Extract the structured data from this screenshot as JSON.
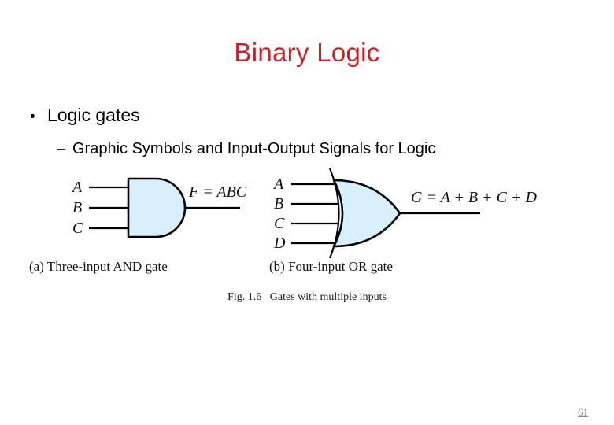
{
  "slide": {
    "title": "Binary Logic",
    "title_color": "#cc2026",
    "background_color": "#ffffff",
    "page_number": "61"
  },
  "bullets": {
    "level1": {
      "marker": "•",
      "text": "Logic gates"
    },
    "level2": {
      "marker": "–",
      "text": "Graphic Symbols and Input-Output Signals for Logic"
    }
  },
  "figure": {
    "caption": "Fig. 1.6   Gates with multiple inputs",
    "gate_fill_color": "#d8f0fb",
    "gate_stroke_color": "#000000",
    "and_gate": {
      "sub_caption": "(a) Three-input AND gate",
      "inputs": [
        "A",
        "B",
        "C"
      ],
      "output_expression": "F = ABC"
    },
    "or_gate": {
      "sub_caption": "(b) Four-input OR gate",
      "inputs": [
        "A",
        "B",
        "C",
        "D"
      ],
      "output_expression": "G = A + B + C + D"
    }
  }
}
